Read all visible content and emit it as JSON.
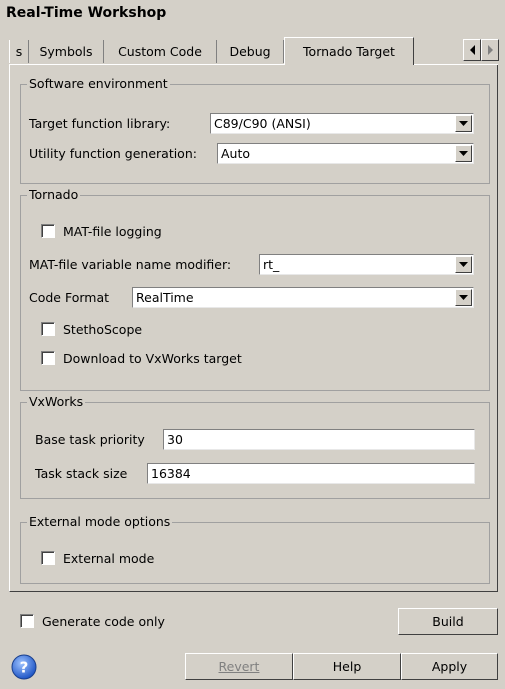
{
  "window": {
    "title": "Real-Time Workshop"
  },
  "tabs": {
    "items": [
      {
        "label": "s"
      },
      {
        "label": "Symbols"
      },
      {
        "label": "Custom Code"
      },
      {
        "label": "Debug"
      },
      {
        "label": "Tornado Target",
        "active": true
      }
    ],
    "scroll_left": "arrow-left-icon",
    "scroll_right": "arrow-right-icon"
  },
  "software_environment": {
    "legend": "Software environment",
    "target_function_library": {
      "label": "Target function library:",
      "value": "C89/C90 (ANSI)"
    },
    "utility_function_generation": {
      "label": "Utility function generation:",
      "value": "Auto"
    }
  },
  "tornado": {
    "legend": "Tornado",
    "mat_file_logging": {
      "label": "MAT-file logging",
      "checked": false
    },
    "mat_file_modifier": {
      "label": "MAT-file variable name modifier:",
      "value": "rt_"
    },
    "code_format": {
      "label": "Code Format",
      "value": "RealTime"
    },
    "stethoscope": {
      "label": "StethoScope",
      "checked": false
    },
    "download_vxworks": {
      "label": "Download to VxWorks target",
      "checked": false
    }
  },
  "vxworks": {
    "legend": "VxWorks",
    "base_task_priority": {
      "label": "Base task priority",
      "value": "30"
    },
    "task_stack_size": {
      "label": "Task stack size",
      "value": "16384"
    }
  },
  "external_mode_options": {
    "legend": "External mode options",
    "external_mode": {
      "label": "External mode",
      "checked": false
    }
  },
  "bottom": {
    "generate_code_only": {
      "label": "Generate code only",
      "checked": false
    },
    "build_label": "Build",
    "revert_label": "Revert",
    "help_label": "Help",
    "apply_label": "Apply",
    "help_icon": "question-circle-icon"
  }
}
